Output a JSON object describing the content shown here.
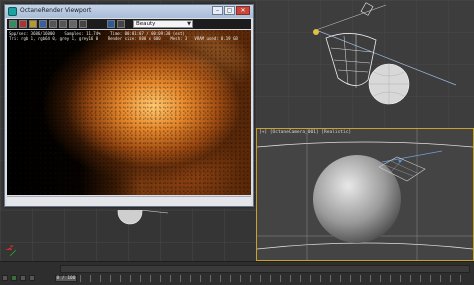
{
  "render_window": {
    "title": "OctaneRender Viewport",
    "pass_select": "Beauty",
    "stats_line1": "Spp/sec: 3686/16000    Samples: 11.74%    Time: 00:01:07 / 00:09:30 (est)",
    "stats_line2": "Tri: rgb 1, rgb64 0, grey 1, grey16 0    Render size: 800 x 600    Mesh: 3   VRAM used: 0.19 GB"
  },
  "viewports": {
    "camera_label": "[+] [OctaneCamera_001] [Realistic]"
  },
  "timeline": {
    "frame_display": "0 / 100"
  },
  "colors": {
    "active_viewport_border": "#c9a227",
    "octane_icon": "#1aa3a0",
    "close_button": "#c9463d",
    "camera_frustum": "#6ea0d8"
  }
}
